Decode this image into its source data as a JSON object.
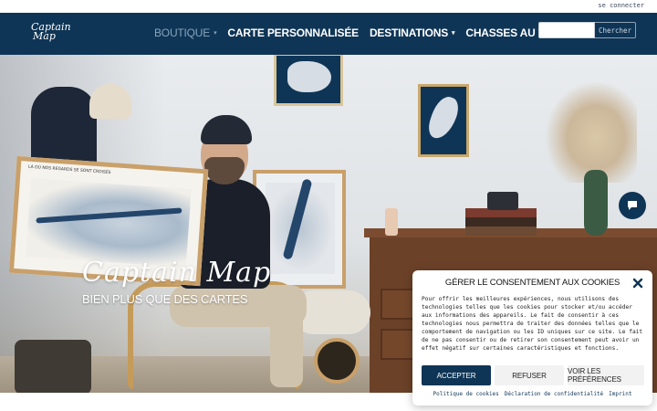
{
  "topbar": {
    "login_link": "se connecter"
  },
  "header": {
    "logo_line1": "Captain",
    "logo_line2": "Map",
    "nav": [
      {
        "label": "Boutique",
        "has_dropdown": true,
        "active": true
      },
      {
        "label": "Carte personnalisée",
        "has_dropdown": false,
        "active": false
      },
      {
        "label": "Destinations",
        "has_dropdown": true,
        "active": false
      },
      {
        "label": "Chasses au trésor",
        "has_dropdown": false,
        "active": false
      }
    ],
    "search": {
      "placeholder": "",
      "button_label": "Chercher"
    }
  },
  "hero": {
    "script_title": "Captain Map",
    "tagline": "Bien plus que des cartes",
    "big_frame_caption": "LÀ OÙ NOS REGARDS SE SONT CROISÉS"
  },
  "cookie_dialog": {
    "title": "Gérer le consentement aux cookies",
    "body": "Pour offrir les meilleures expériences, nous utilisons des technologies telles que les cookies pour stocker et/ou accéder aux informations des appareils. Le fait de consentir à ces technologies nous permettra de traiter des données telles que le comportement de navigation ou les ID uniques sur ce site. Le fait de ne pas consentir ou de retirer son consentement peut avoir un effet négatif sur certaines caractéristiques et fonctions.",
    "accept_label": "Accepter",
    "refuse_label": "Refuser",
    "prefs_label": "Voir les préférences",
    "links": [
      "Politique de cookies",
      "Déclaration de confidentialité",
      "Imprint"
    ]
  },
  "colors": {
    "brand_navy": "#0f3556",
    "nav_active": "#86a4bd",
    "frame_gold": "#c9a06a"
  },
  "icons": {
    "close": "close-icon",
    "chat": "chat-bubble-icon",
    "chevron": "chevron-down-icon"
  }
}
